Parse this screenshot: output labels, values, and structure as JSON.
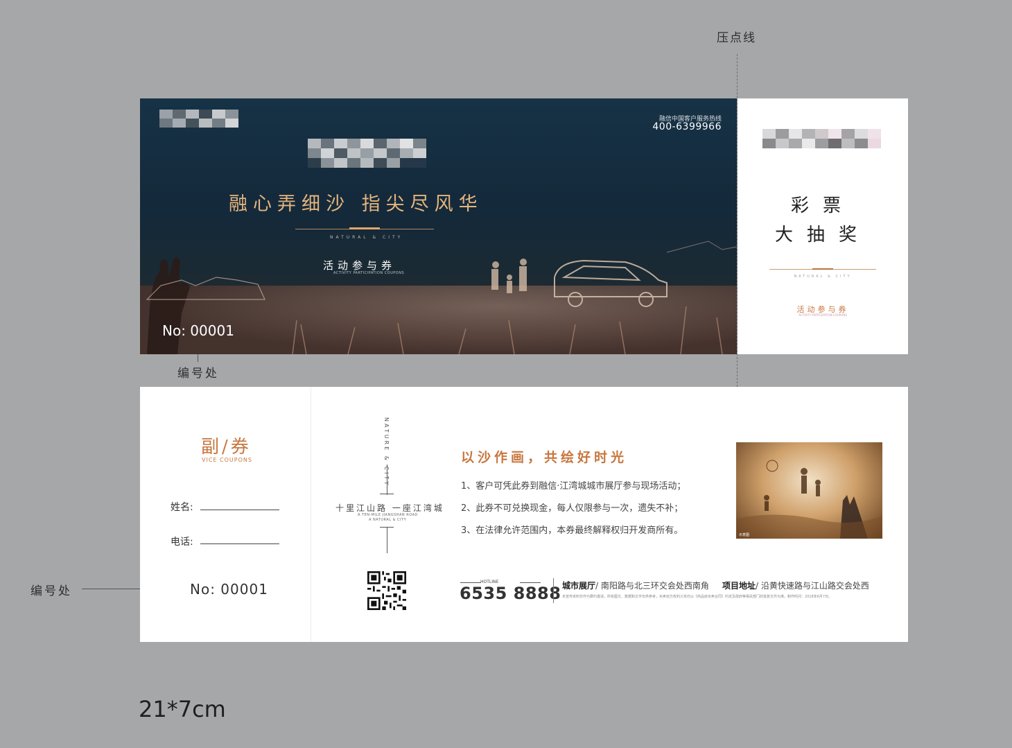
{
  "annotations": {
    "press_line": "压点线",
    "number_position_top": "编号处",
    "number_position_left": "编号处",
    "size": "21*7cm"
  },
  "main_ticket": {
    "hotline_label": "融信中国客户服务热线",
    "hotline_number": "400-6399966",
    "slogan": "融心弄细沙  指尖尽风华",
    "subtitle_en": "NATURAL & CITY",
    "activity": "活动参与券",
    "activity_en": "ACTIVITY PARTICIPATION COUPONS",
    "serial": "No: 00001"
  },
  "lottery_stub": {
    "title_line1": "彩票",
    "title_line2": "大抽奖",
    "subtitle_en": "NATURAL & CITY",
    "activity": "活动参与券",
    "activity_en": "ACTIVITY PARTICIPATION COUPONS"
  },
  "vice_coupon": {
    "title": "副/券",
    "title_en": "VICE COUPONS",
    "name_label": "姓名:",
    "phone_label": "电话:",
    "serial": "No: 00001"
  },
  "brand_panel": {
    "vertical_en": "NATURE & CITY",
    "road_line": "十里江山路  一座江湾城",
    "road_en_1": "A TEN-MILE JIANGSHAN ROAD",
    "road_en_2": "A NATURAL & CITY"
  },
  "info_panel": {
    "headline": "以沙作画，共绘好时光",
    "rules": [
      "1、客户可凭此券到融信·江湾城城市展厅参与现场活动；",
      "2、此券不可兑换现金，每人仅限参与一次，遗失不补；",
      "3、在法律允许范围内，本券最终解释权归开发商所有。"
    ],
    "photo_caption": "示意图",
    "hotline_label": "HOTLINE",
    "hotline_number": "6535 8888",
    "showroom_label": "城市展厅",
    "showroom_address": "/ 南阳路与北三环交会处西南角",
    "project_label": "项目地址",
    "project_address": "/ 沿黄快速路与江山路交会处西",
    "legal": "本宣传资料仅作为要约邀请，所有图文、数据和文字仅供参考，买卖双方权利义务均以《商品房买卖合同》约定及政府等相关部门的批复文件为准。制作时间：2018年6月7日。"
  },
  "colors": {
    "background": "#a6a7a9",
    "accent": "#c7773f",
    "gold": "#e6b57d",
    "navy": "#163246"
  }
}
